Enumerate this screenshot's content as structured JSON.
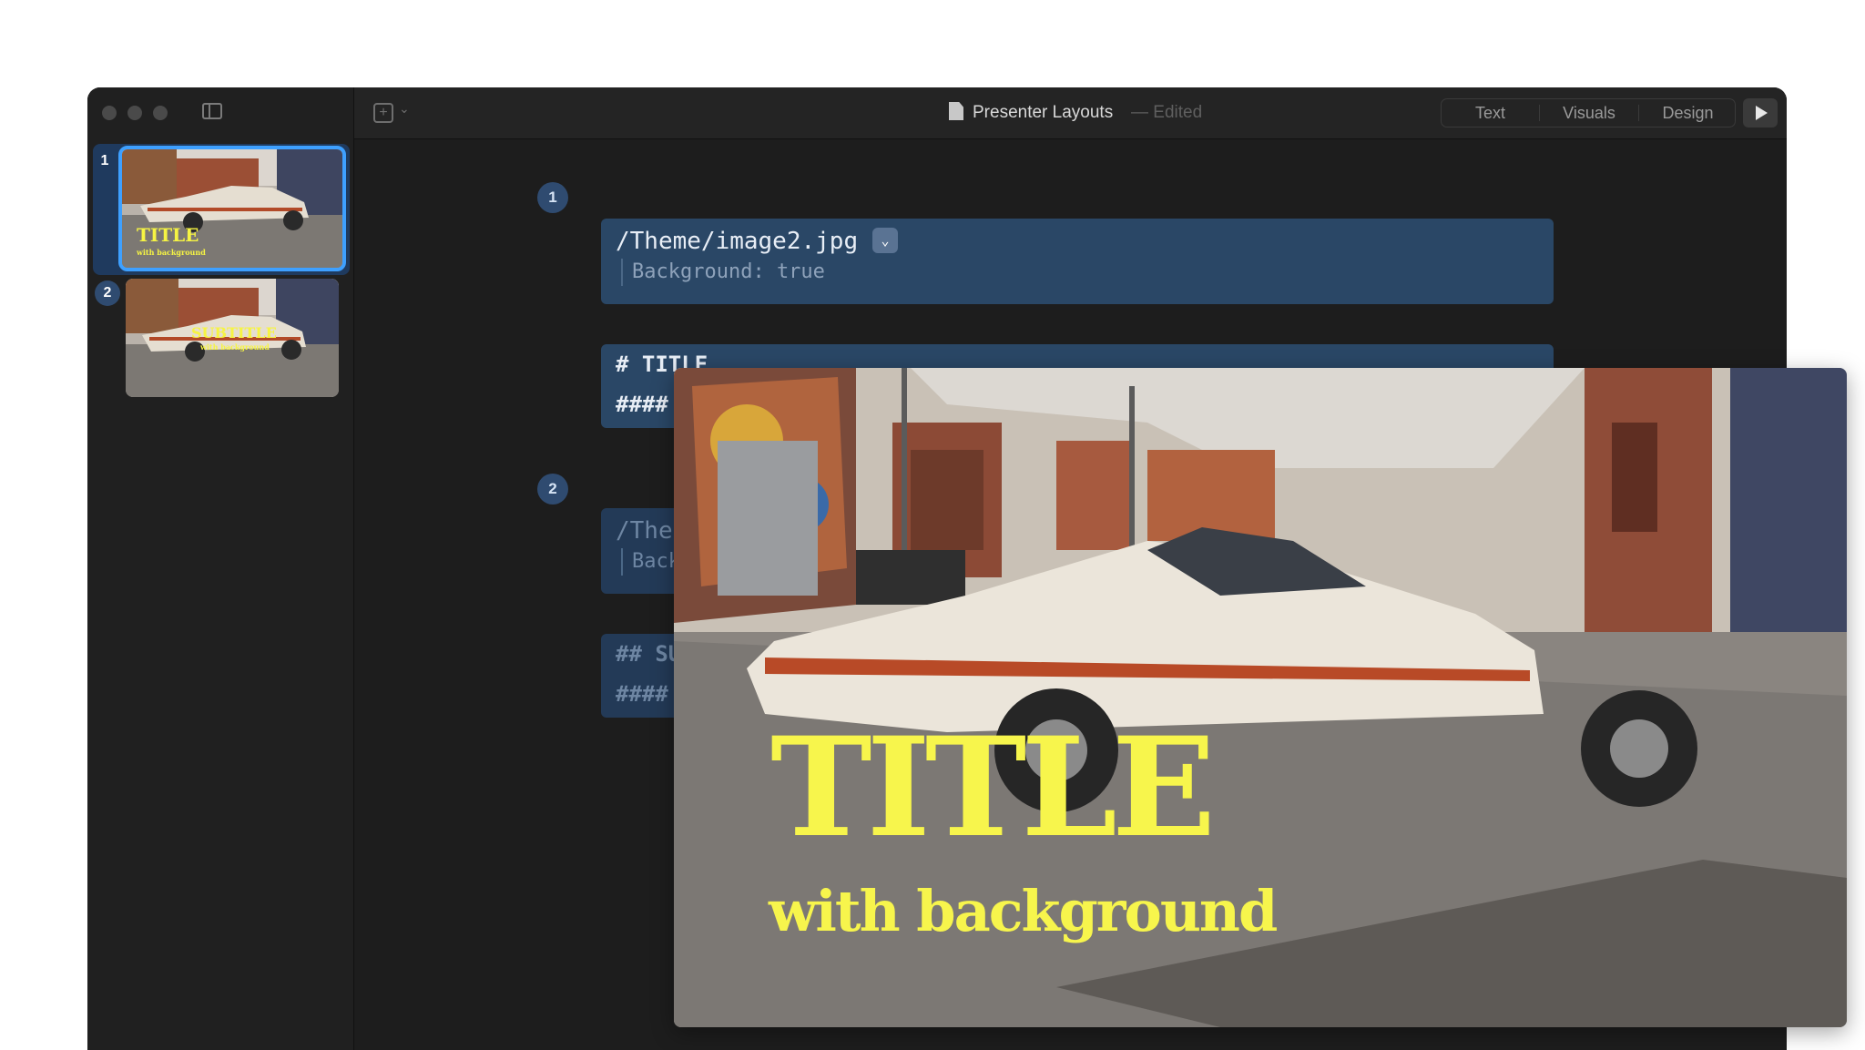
{
  "window": {
    "title": "Presenter Layouts",
    "status": "— Edited"
  },
  "toolbar": {
    "tabs": [
      "Text",
      "Visuals",
      "Design"
    ]
  },
  "sidebar": {
    "slides": [
      {
        "number": "1",
        "title": "TITLE",
        "subtitle": "with background",
        "selected": true
      },
      {
        "number": "2",
        "title": "SUBTITLE",
        "subtitle": "with background",
        "selected": false
      }
    ]
  },
  "editor": {
    "slides": [
      {
        "number": "1",
        "image_path": "/Theme/image2.jpg",
        "property": "Background: true",
        "lines": [
          "# TITLE",
          "####"
        ]
      },
      {
        "number": "2",
        "image_path": "/Ther",
        "property": "Back",
        "lines": [
          "## SU",
          "####"
        ]
      }
    ],
    "separator": "---"
  },
  "preview": {
    "title": "TITLE",
    "subtitle": "with background",
    "text_color": "#f7f54c"
  },
  "colors": {
    "accent": "#3ea0ff",
    "block": "#2a4766",
    "badge": "#2f4b70"
  }
}
